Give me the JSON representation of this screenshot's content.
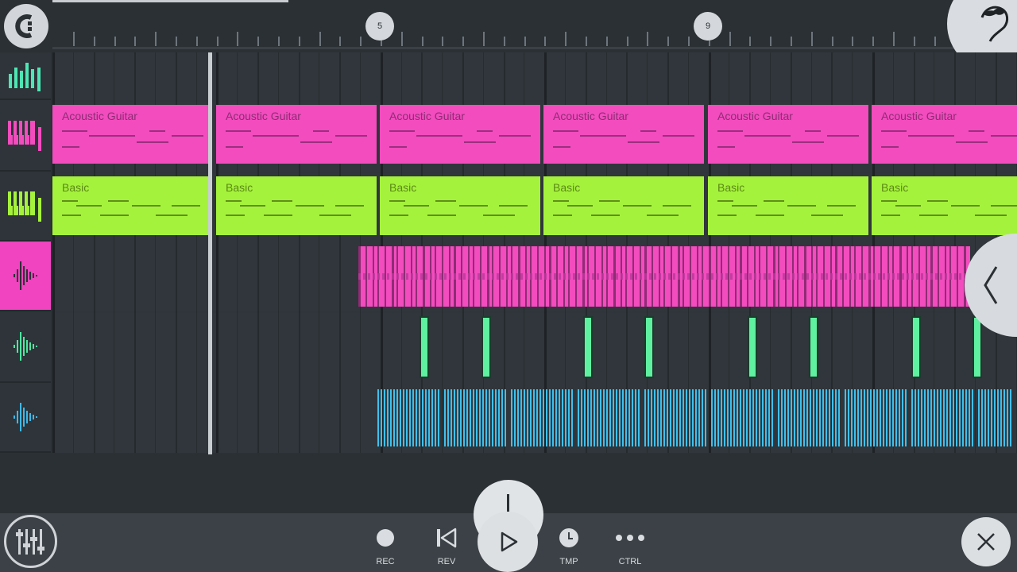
{
  "ruler": {
    "bar_markers": [
      "5",
      "9"
    ]
  },
  "tracks": [
    {
      "icon": "drum-pattern-icon",
      "color": "#4ee6b4"
    },
    {
      "icon": "keyboard-icon",
      "color": "#f24cbe"
    },
    {
      "icon": "keyboard-icon",
      "color": "#a5f23c"
    },
    {
      "icon": "waveform-icon",
      "color": "#2b3035",
      "selected": true
    },
    {
      "icon": "waveform-icon",
      "color": "#4ee6a0"
    },
    {
      "icon": "waveform-icon",
      "color": "#3fb8e8"
    }
  ],
  "clips": {
    "guitar_label": "Acoustic Guitar",
    "basic_label": "Basic",
    "guitar_color": "#f24cbe",
    "basic_color": "#a5f23c",
    "audio_pink_color": "#f24cbe",
    "audio_green_color": "#5ff0a0",
    "audio_blue_color": "#3fc0ec",
    "guitar_clips": [
      "Acoustic Guitar",
      "Acoustic Guitar",
      "Acoustic Guitar",
      "Acoustic Guitar",
      "Acoustic Guitar",
      "Acoustic Guitar"
    ],
    "basic_clips": [
      "Basic",
      "Basic",
      "Basic",
      "Basic",
      "Basic",
      "Basic"
    ]
  },
  "transport": {
    "rec_label": "REC",
    "rev_label": "REV",
    "tmp_label": "TMP",
    "ctrl_label": "CTRL"
  },
  "colors": {
    "background": "#2b3035",
    "lane": "#30363b",
    "accent_pink": "#f044c0"
  }
}
